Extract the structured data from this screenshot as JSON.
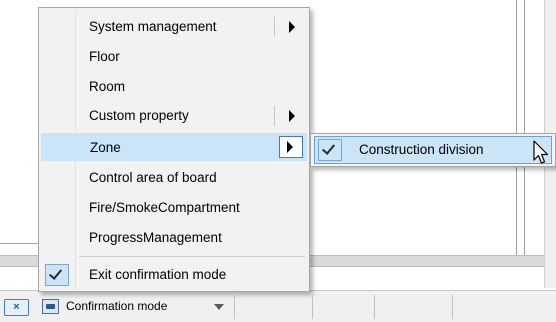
{
  "context_menu": {
    "items": [
      {
        "label": "System management",
        "has_submenu": true
      },
      {
        "label": "Floor",
        "has_submenu": false
      },
      {
        "label": "Room",
        "has_submenu": false
      },
      {
        "label": "Custom property",
        "has_submenu": true
      },
      {
        "label": "Zone",
        "has_submenu": true,
        "highlighted": true
      },
      {
        "label": "Control area of board",
        "has_submenu": false
      },
      {
        "label": "Fire/SmokeCompartment",
        "has_submenu": false
      },
      {
        "label": "ProgressManagement",
        "has_submenu": false
      }
    ],
    "exit_item": {
      "label": "Exit confirmation mode",
      "checked": true
    }
  },
  "submenu": {
    "items": [
      {
        "label": "Construction division",
        "checked": true
      }
    ]
  },
  "statusbar": {
    "confirmation_mode_label": "Confirmation mode",
    "mode_icon_text": "×",
    "mode_icon": "confirmation-x-icon"
  },
  "colors": {
    "menu_bg": "#f2f2f2",
    "highlight": "#cce4f7",
    "highlight_border": "#3c7fb1"
  }
}
